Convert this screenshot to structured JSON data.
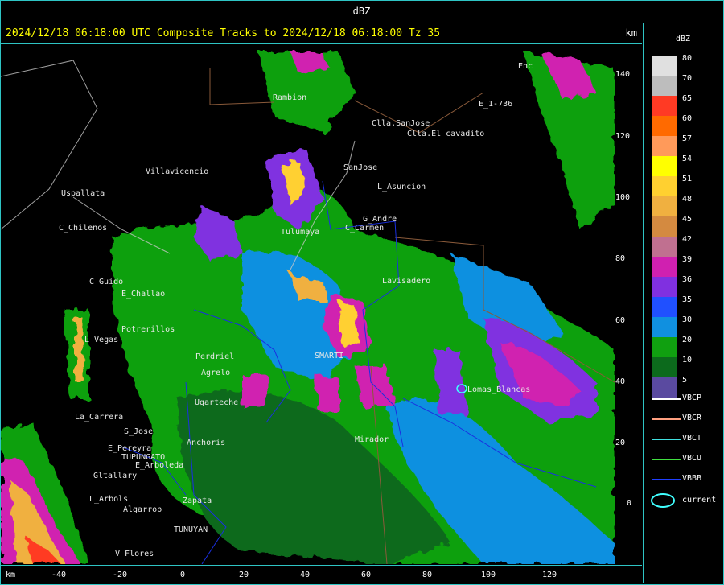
{
  "window_title": "dBZ",
  "header": {
    "title": "2024/12/18 06:18:00 UTC Composite Tracks to 2024/12/18 06:18:00 Tz 35",
    "unit": "km"
  },
  "axes": {
    "x_unit": "km",
    "x_ticks": [
      "-40",
      "-20",
      "0",
      "20",
      "40",
      "60",
      "80",
      "100",
      "120"
    ],
    "y_ticks": [
      "140",
      "120",
      "100",
      "80",
      "60",
      "40",
      "20",
      "0"
    ]
  },
  "legend": {
    "title": "dBZ",
    "scale": [
      {
        "value": "80",
        "color": "#e0e0e0"
      },
      {
        "value": "70",
        "color": "#bdbdbd"
      },
      {
        "value": "65",
        "color": "#ff3a24"
      },
      {
        "value": "60",
        "color": "#ff6a00"
      },
      {
        "value": "57",
        "color": "#ff9a5a"
      },
      {
        "value": "54",
        "color": "#ffff00"
      },
      {
        "value": "51",
        "color": "#ffd030"
      },
      {
        "value": "48",
        "color": "#f0b040"
      },
      {
        "value": "45",
        "color": "#d48a40"
      },
      {
        "value": "42",
        "color": "#c07090"
      },
      {
        "value": "39",
        "color": "#d020b0"
      },
      {
        "value": "36",
        "color": "#8030e0"
      },
      {
        "value": "35",
        "color": "#2050ff"
      },
      {
        "value": "30",
        "color": "#1090e0"
      },
      {
        "value": "20",
        "color": "#10a010"
      },
      {
        "value": "10",
        "color": "#0c6a1c"
      },
      {
        "value": "5",
        "color": "#5a4aa0"
      }
    ],
    "tracks": [
      {
        "label": "VBCP",
        "color": "#ffffff"
      },
      {
        "label": "VBCR",
        "color": "#ffa080"
      },
      {
        "label": "VBCT",
        "color": "#40e0e0"
      },
      {
        "label": "VBCU",
        "color": "#40e040"
      },
      {
        "label": "VBBB",
        "color": "#2040ff"
      }
    ],
    "current_label": "current"
  },
  "places": [
    {
      "name": "Rambion"
    },
    {
      "name": "Clla.SanJose"
    },
    {
      "name": "Clla.El_cavadito"
    },
    {
      "name": "SanJose"
    },
    {
      "name": "L_Asuncion"
    },
    {
      "name": "E_1-736"
    },
    {
      "name": "Villavicencio"
    },
    {
      "name": "Uspallata"
    },
    {
      "name": "C_Chilenos"
    },
    {
      "name": "C_Guido"
    },
    {
      "name": "E_Challao"
    },
    {
      "name": "L_Vegas"
    },
    {
      "name": "Potrerillos"
    },
    {
      "name": "Perdriel"
    },
    {
      "name": "Agrelo"
    },
    {
      "name": "Ugarteche"
    },
    {
      "name": "La_Carrera"
    },
    {
      "name": "S_Jose"
    },
    {
      "name": "Anchoris"
    },
    {
      "name": "E_Pereyra"
    },
    {
      "name": "TUPUNGATO"
    },
    {
      "name": "E_Arboleda"
    },
    {
      "name": "Gltallary"
    },
    {
      "name": "L_Arbols"
    },
    {
      "name": "Algarrob"
    },
    {
      "name": "Zapata"
    },
    {
      "name": "TUNUYAN"
    },
    {
      "name": "V_Flores"
    },
    {
      "name": "Mirador"
    },
    {
      "name": "G_Andre"
    },
    {
      "name": "C_Carmen"
    },
    {
      "name": "Lavisadero"
    },
    {
      "name": "Lomas_Blancas"
    },
    {
      "name": "Enc"
    },
    {
      "name": "SMARTI"
    },
    {
      "name": "Tulumaya"
    }
  ]
}
